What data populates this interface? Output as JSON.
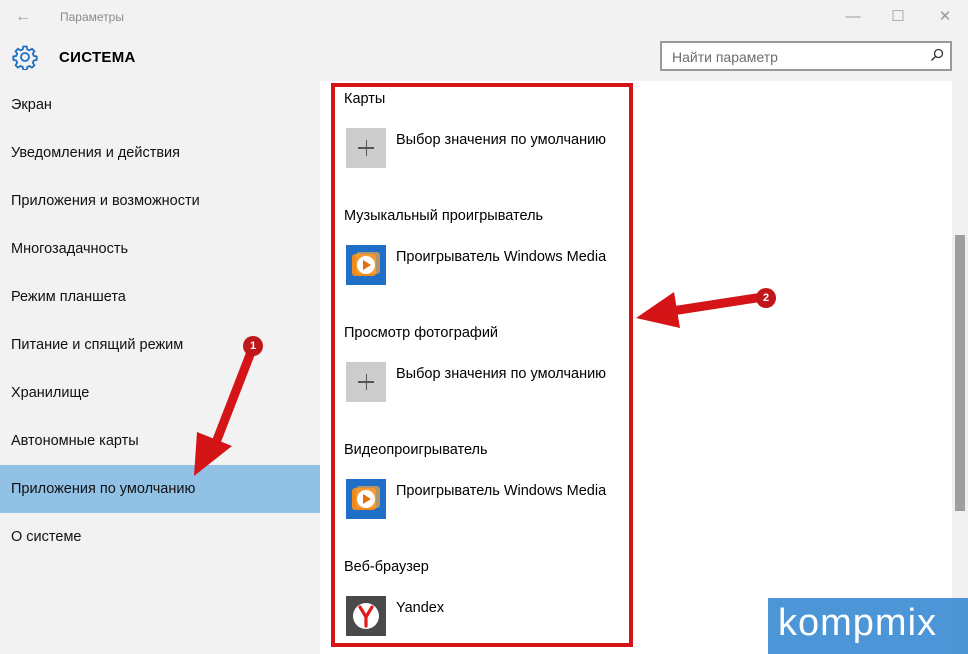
{
  "window": {
    "title": "Параметры",
    "back_glyph": "←",
    "minimize_glyph": "—",
    "maximize_glyph": "☐",
    "close_glyph": "✕"
  },
  "header": {
    "title": "СИСТЕМА",
    "search_placeholder": "Найти параметр"
  },
  "sidebar": {
    "selected_index": 8,
    "items": [
      {
        "label": "Экран"
      },
      {
        "label": "Уведомления и действия"
      },
      {
        "label": "Приложения и возможности"
      },
      {
        "label": "Многозадачность"
      },
      {
        "label": "Режим планшета"
      },
      {
        "label": "Питание и спящий режим"
      },
      {
        "label": "Хранилище"
      },
      {
        "label": "Автономные карты"
      },
      {
        "label": "Приложения по умолчанию"
      },
      {
        "label": "О системе"
      }
    ]
  },
  "content": {
    "sections": [
      {
        "title": "Карты",
        "app_label": "Выбор значения по умолчанию",
        "icon": "plus-icon"
      },
      {
        "title": "Музыкальный проигрыватель",
        "app_label": "Проигрыватель Windows Media",
        "icon": "windows-media-player-icon"
      },
      {
        "title": "Просмотр фотографий",
        "app_label": "Выбор значения по умолчанию",
        "icon": "plus-icon"
      },
      {
        "title": "Видеопроигрыватель",
        "app_label": "Проигрыватель Windows Media",
        "icon": "windows-media-player-icon"
      },
      {
        "title": "Веб-браузер",
        "app_label": "Yandex",
        "icon": "yandex-icon"
      }
    ]
  },
  "annotations": {
    "badge_1": "1",
    "badge_2": "2",
    "color": "#d51417"
  },
  "watermark": {
    "text": "kompmix"
  },
  "colors": {
    "selected_nav": "#92c1e6",
    "chrome": "#f2f2f2",
    "wmp_blue": "#1f6fc8"
  }
}
